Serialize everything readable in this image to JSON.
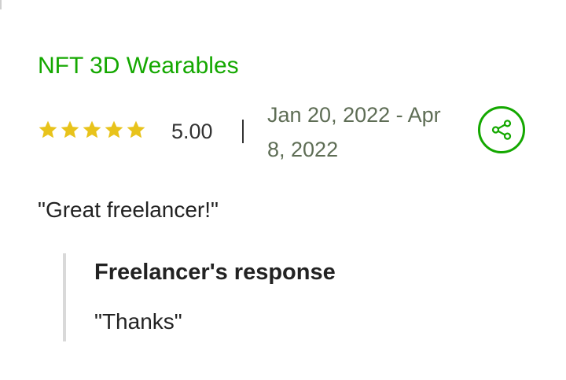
{
  "review": {
    "title": "NFT 3D Wearables",
    "rating": "5.00",
    "stars_filled": 5,
    "stars_total": 5,
    "date_range": "Jan 20, 2022 - Apr 8, 2022",
    "feedback": "\"Great freelancer!\"",
    "response": {
      "heading": "Freelancer's response",
      "text": "\"Thanks\""
    }
  },
  "icons": {
    "star": "star-icon",
    "share": "share-icon"
  },
  "colors": {
    "title_green": "#14a800",
    "star_gold": "#e8c31b",
    "date_text": "#5e6d55",
    "response_border": "#d9d9d9"
  }
}
